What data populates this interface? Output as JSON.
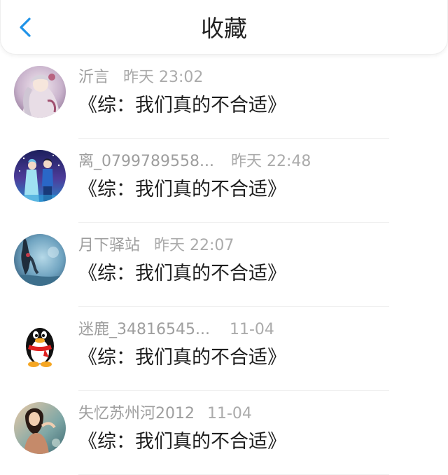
{
  "header": {
    "title": "收藏",
    "back_icon": "chevron-left-icon"
  },
  "colors": {
    "accent": "#1f93e8",
    "meta_text": "#9e9e9e",
    "content_text": "#1e1e1e"
  },
  "items": [
    {
      "name": "沂言",
      "time": "昨天 23:02",
      "content": "《综：我们真的不合适》",
      "avatar_icon": "anime-girl-avatar"
    },
    {
      "name": "离_0799789558...",
      "time": "昨天 22:48",
      "content": "《综：我们真的不合适》",
      "avatar_icon": "couple-illustration-avatar"
    },
    {
      "name": "月下驿站",
      "time": "昨天 22:07",
      "content": "《综：我们真的不合适》",
      "avatar_icon": "blue-scenery-avatar"
    },
    {
      "name": "迷鹿_34816545...",
      "time": "11-04",
      "content": "《综：我们真的不合适》",
      "avatar_icon": "qq-penguin-avatar"
    },
    {
      "name": "失忆苏州河2012",
      "time": "11-04",
      "content": "《综：我们真的不合适》",
      "avatar_icon": "photo-girl-avatar"
    }
  ]
}
